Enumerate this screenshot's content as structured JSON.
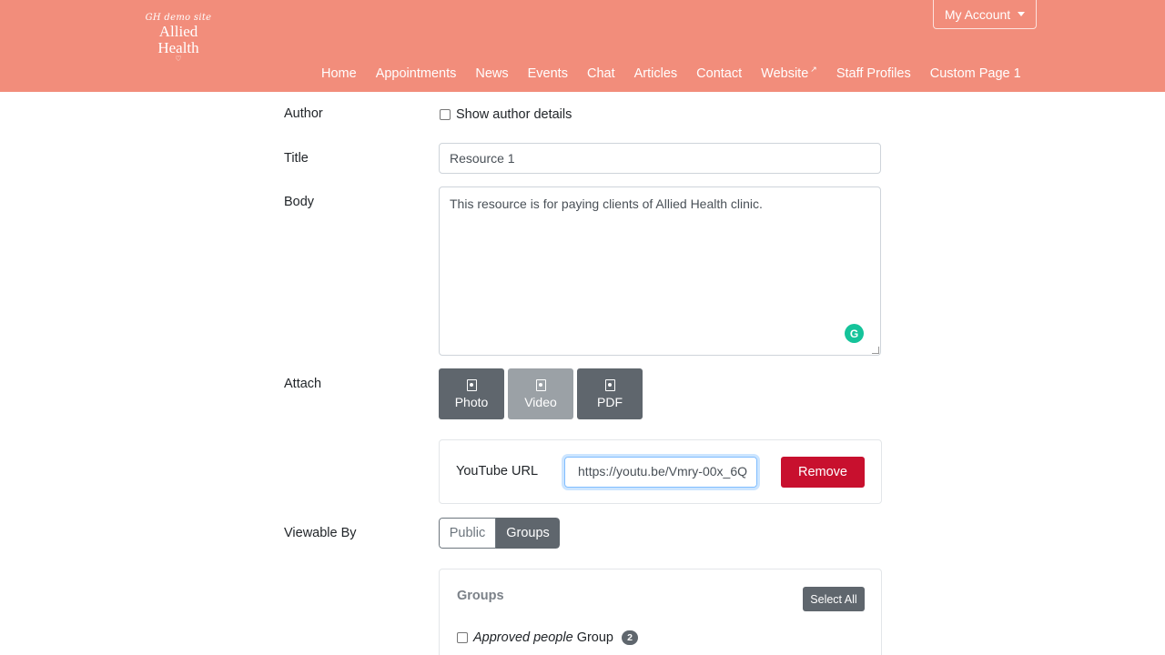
{
  "header": {
    "logo": {
      "script": "GH demo site",
      "brand_line1": "Allied",
      "brand_line2": "Health",
      "heart": "♡"
    },
    "account_label": "My Account",
    "nav": [
      {
        "label": "Home"
      },
      {
        "label": "Appointments"
      },
      {
        "label": "News"
      },
      {
        "label": "Events"
      },
      {
        "label": "Chat"
      },
      {
        "label": "Articles"
      },
      {
        "label": "Contact"
      },
      {
        "label": "Website",
        "external_icon": "↗"
      },
      {
        "label": "Staff Profiles"
      },
      {
        "label": "Custom Page 1"
      }
    ]
  },
  "form": {
    "author": {
      "label": "Author",
      "option_label": "Show author details"
    },
    "title": {
      "label": "Title",
      "value": "Resource 1"
    },
    "body": {
      "label": "Body",
      "value": "This resource is for paying clients of Allied Health clinic.",
      "grammarly_letter": "G"
    },
    "attach": {
      "label": "Attach",
      "buttons": [
        {
          "label": "Photo",
          "icon": "image-file-icon",
          "active": false
        },
        {
          "label": "Video",
          "icon": "video-file-icon",
          "active": true
        },
        {
          "label": "PDF",
          "icon": "pdf-file-icon",
          "active": false
        }
      ]
    },
    "youtube": {
      "label": "YouTube URL",
      "value": "https://youtu.be/Vmry-00x_6Q",
      "remove_label": "Remove"
    },
    "viewable_by": {
      "label": "Viewable By",
      "options": [
        "Public",
        "Groups"
      ],
      "selected": "Groups"
    },
    "groups": {
      "title": "Groups",
      "select_all_label": "Select All",
      "items": [
        {
          "italic": "Approved people",
          "text": "Group",
          "count": "2"
        }
      ]
    }
  },
  "colors": {
    "header": "#f28d7b",
    "button_dark": "#5f666d",
    "danger": "#c8102e",
    "focus": "#80bdff"
  }
}
